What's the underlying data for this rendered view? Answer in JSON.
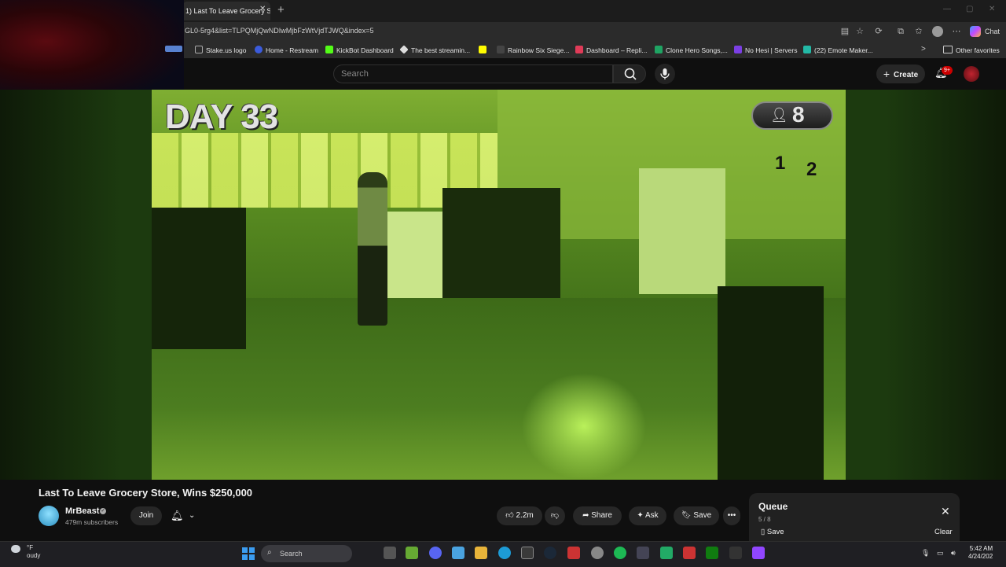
{
  "browser": {
    "tab_title": "1) Last To Leave Grocery St",
    "tab_close": "✕",
    "new_tab": "+",
    "url": "GL0-5rg4&list=TLPQMjQwNDIwMjbFzWtVjdTJWQ&index=5",
    "chat_label": "Chat",
    "bookmarks": [
      {
        "label": "Stake.us logo",
        "color": "#2b2b2b"
      },
      {
        "label": "Home - Restream",
        "color": "#3b5bdb"
      },
      {
        "label": "KickBot Dashboard",
        "color": "#53fc18"
      },
      {
        "label": "The best streamin...",
        "color": "#dddddd"
      },
      {
        "label": "",
        "color": "#fffc00"
      },
      {
        "label": "Rainbow Six Siege...",
        "color": "#444444"
      },
      {
        "label": "Dashboard – Repli...",
        "color": "#e03b58"
      },
      {
        "label": "Clone Hero Songs,...",
        "color": "#1fa463"
      },
      {
        "label": "No Hesi | Servers",
        "color": "#7b3fe4"
      },
      {
        "label": "(22) Emote Maker...",
        "color": "#23b9a6"
      }
    ],
    "bookmarks_more": ">",
    "other_favorites": "Other favorites"
  },
  "youtube": {
    "search_placeholder": "Search",
    "create_label": "Create",
    "create_icon": "+",
    "notifications_badge": "9+"
  },
  "video": {
    "overlay_day": "DAY 33",
    "overlay_count": "8",
    "register_numbers": [
      "1",
      "2"
    ],
    "title": "Last To Leave Grocery Store, Wins $250,000"
  },
  "channel": {
    "name": "MrBeast",
    "verified_mark": "✓",
    "subscribers": "479m subscribers",
    "join_label": "Join"
  },
  "actions": {
    "likes": "2.2m",
    "share_label": "Share",
    "ask_label": "Ask",
    "save_label": "Save",
    "more": "•••"
  },
  "queue": {
    "title": "Queue",
    "position": "5 / 8",
    "close": "✕",
    "save_label": "Save",
    "clear_label": "Clear"
  },
  "taskbar": {
    "weather_temp": "°F",
    "weather_desc": "oudy",
    "search_label": "Search",
    "time": "5:42 AM",
    "date": "4/24/202"
  }
}
